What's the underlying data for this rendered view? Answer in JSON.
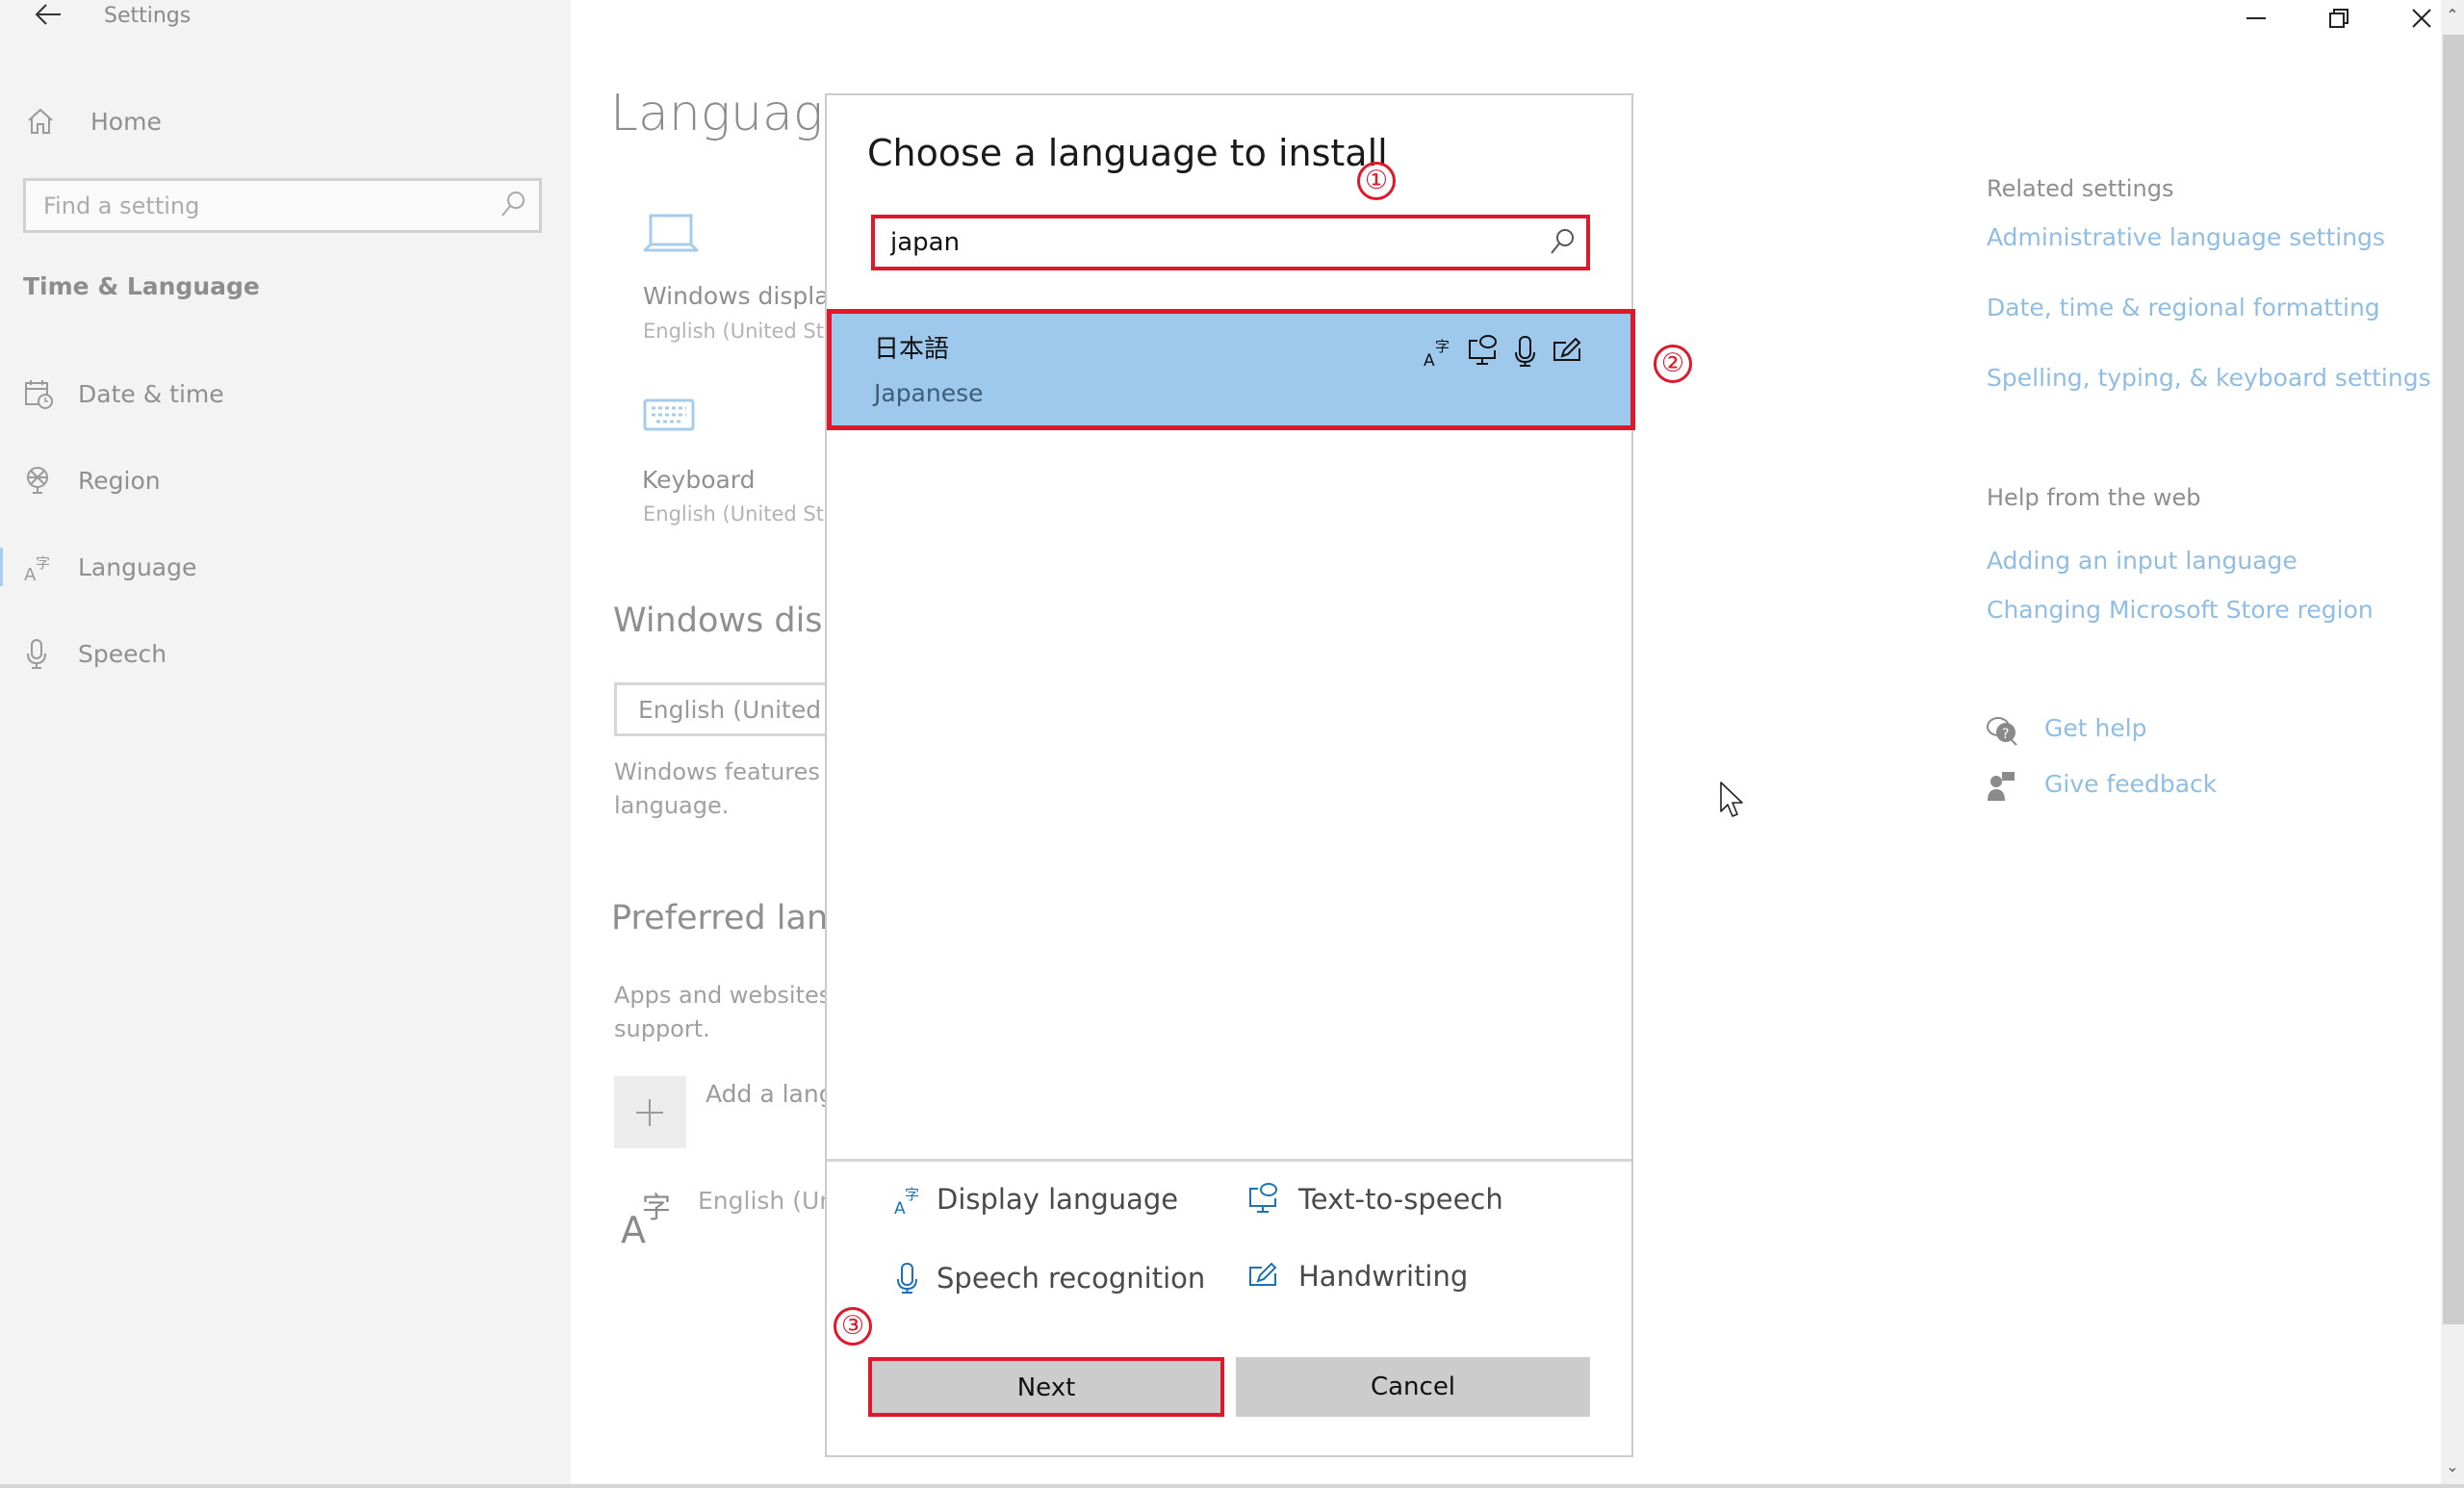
{
  "window": {
    "title": "Settings",
    "controls": {
      "minimize": "minimize",
      "restore": "restore",
      "close": "close"
    }
  },
  "sidebar": {
    "home_label": "Home",
    "search_placeholder": "Find a setting",
    "section_title": "Time & Language",
    "items": [
      {
        "label": "Date & time",
        "icon": "calendar-clock-icon"
      },
      {
        "label": "Region",
        "icon": "globe-icon"
      },
      {
        "label": "Language",
        "icon": "language-icon",
        "active": true
      },
      {
        "label": "Speech",
        "icon": "microphone-icon"
      }
    ]
  },
  "main": {
    "page_title": "Language",
    "tiles": [
      {
        "title": "Windows display",
        "subtitle": "English (United Sta",
        "icon": "laptop-icon"
      },
      {
        "title": "Keyboard",
        "subtitle": "English (United Sta",
        "icon": "keyboard-icon"
      }
    ],
    "windows_display_heading": "Windows disp",
    "display_language_value": "English (United S",
    "display_language_desc_line1": "Windows features l",
    "display_language_desc_line2": "language.",
    "preferred_heading": "Preferred lang",
    "preferred_desc_line1": "Apps and websites",
    "preferred_desc_line2": "support.",
    "add_language_label": "Add a lang",
    "installed_language_label": "English (Un"
  },
  "right_panel": {
    "related_heading": "Related settings",
    "related_links": [
      "Administrative language settings",
      "Date, time & regional formatting",
      "Spelling, typing, & keyboard settings"
    ],
    "help_heading": "Help from the web",
    "help_links": [
      "Adding an input language",
      "Changing Microsoft Store region"
    ],
    "get_help": "Get help",
    "give_feedback": "Give feedback"
  },
  "dialog": {
    "title": "Choose a language to install",
    "search_value": "japan",
    "results": [
      {
        "native_name": "日本語",
        "english_name": "Japanese",
        "selected": true,
        "features": [
          "display-language",
          "text-to-speech",
          "speech-recognition",
          "handwriting"
        ]
      }
    ],
    "legend": {
      "display_language": "Display language",
      "text_to_speech": "Text-to-speech",
      "speech_recognition": "Speech recognition",
      "handwriting": "Handwriting"
    },
    "next_label": "Next",
    "cancel_label": "Cancel"
  },
  "annotations": {
    "step1": "①",
    "step2": "②",
    "step3": "③",
    "color": "#e0182c"
  },
  "colors": {
    "accent_link": "#8fbde3",
    "selection": "#9ec9ed",
    "legend_icon": "#1a73b8",
    "button_gray": "#cccccc"
  }
}
